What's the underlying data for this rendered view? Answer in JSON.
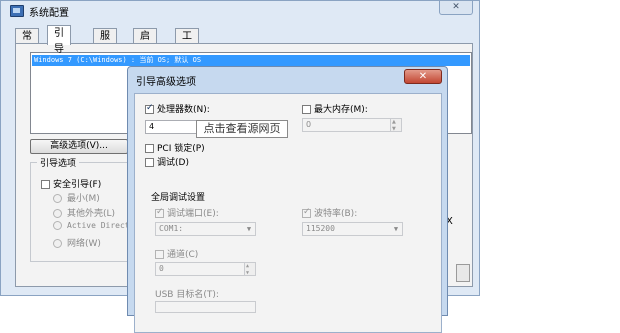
{
  "main_window": {
    "title": "系统配置",
    "close_glyph": "✕",
    "tabs": [
      {
        "label": "常规"
      },
      {
        "label": "引导"
      },
      {
        "label": "服务"
      },
      {
        "label": "启动"
      },
      {
        "label": "工具"
      }
    ],
    "os_entry": "Windows 7 (C:\\Windows) : 当前 OS; 默认 OS",
    "advanced_button": "高级选项(V)...",
    "boot_options": {
      "label": "引导选项",
      "safe_boot": "安全引导(F)",
      "radios": [
        "最小(M)",
        "其他外壳(L)",
        "Active Direct",
        "网络(W)"
      ]
    },
    "right_fragment": "X"
  },
  "dialog": {
    "title": "引导高级选项",
    "close_glyph": "✕",
    "num_processors_label": "处理器数(N):",
    "num_processors_value": "4",
    "max_memory_label": "最大内存(M):",
    "max_memory_value": "0",
    "pci_lock_label": "PCI 锁定(P)",
    "debug_label": "调试(D)",
    "global_debug_label": "全局调试设置",
    "debug_port_label": "调试端口(E):",
    "debug_port_value": "COM1:",
    "baud_rate_label": "波特率(B):",
    "baud_rate_value": "115200",
    "channel_label": "通道(C)",
    "channel_value": "0",
    "usb_target_label": "USB 目标名(T):"
  },
  "tooltip": "点击查看源网页",
  "icons": {
    "app": "system-config-icon",
    "check": "✓",
    "dropdown": "▼"
  }
}
